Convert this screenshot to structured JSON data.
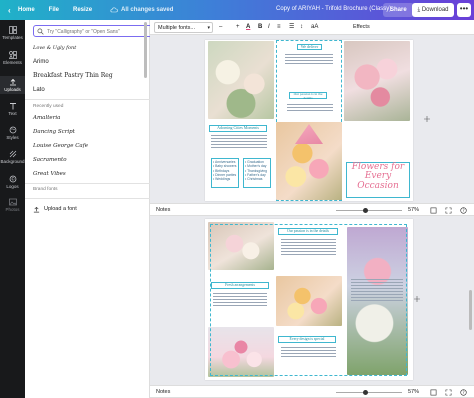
{
  "topbar": {
    "home": "Home",
    "file": "File",
    "resize": "Resize",
    "saved_status": "All changes saved",
    "doc_title": "Copy of ARIYAH - Trifold Brochure (Classy)",
    "share": "Share",
    "download": "Download",
    "more": "•••"
  },
  "rail": {
    "items": [
      {
        "label": "Templates",
        "icon": "templates-icon"
      },
      {
        "label": "Elements",
        "icon": "elements-icon"
      },
      {
        "label": "Uploads",
        "icon": "uploads-icon"
      },
      {
        "label": "Text",
        "icon": "text-icon"
      },
      {
        "label": "Styles",
        "icon": "styles-icon"
      },
      {
        "label": "Background",
        "icon": "background-icon"
      },
      {
        "label": "Logos",
        "icon": "logos-icon"
      },
      {
        "label": "Photos",
        "icon": "photos-icon"
      }
    ]
  },
  "panel": {
    "search_placeholder": "Try \"Calligraphy\" or \"Open Sans\"",
    "fonts_in_use": [
      {
        "name": "Love & Ugly font",
        "checked": true
      },
      {
        "name": "Arimo",
        "checked": true
      },
      {
        "name": "Breakfast Pastry Thin Reg",
        "checked": true
      },
      {
        "name": "Lato",
        "checked": true
      }
    ],
    "recently_used_label": "Recently used",
    "recent_fonts": [
      "Amalteria",
      "Dancing Script",
      "Louise George Cafe",
      "Sacramento",
      "Great Vibes"
    ],
    "brand_fonts_label": "Brand fonts",
    "upload_font": "Upload a font"
  },
  "toolbar": {
    "font": "Multiple fonts...",
    "size_minus": "–",
    "size_plus": "+",
    "effects": "Effects"
  },
  "page1": {
    "heading_top": "We deliver",
    "heading_mid": "Our passion is in the details",
    "col_heading": "Adorning Cities Moments",
    "list_left": [
      "Anniversaries",
      "Baby showers",
      "Birthdays",
      "Dinner parties",
      "Weddings"
    ],
    "list_right": [
      "Graduation",
      "Mother's day",
      "Thanksgiving",
      "Father's day",
      "Christmas"
    ],
    "script_title_1": "Flowers for Every",
    "script_title_2": "Occasion"
  },
  "page2": {
    "heading_a": "Our passion is in the details",
    "heading_b": "Fresh arrangements",
    "heading_c": "Every design is special"
  },
  "pagebar": {
    "notes": "Notes",
    "zoom": "57%",
    "zoom_fraction": 0.57
  }
}
